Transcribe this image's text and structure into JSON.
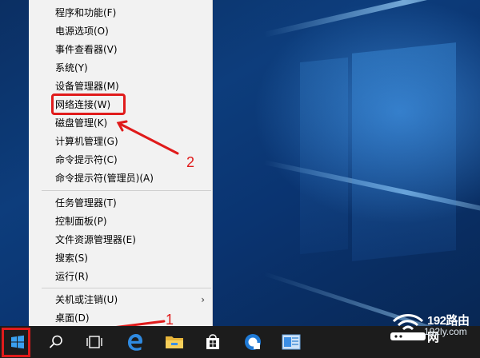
{
  "menu": {
    "items": [
      {
        "label": "程序和功能(F)"
      },
      {
        "label": "电源选项(O)"
      },
      {
        "label": "事件查看器(V)"
      },
      {
        "label": "系统(Y)"
      },
      {
        "label": "设备管理器(M)"
      },
      {
        "label": "网络连接(W)"
      },
      {
        "label": "磁盘管理(K)"
      },
      {
        "label": "计算机管理(G)"
      },
      {
        "label": "命令提示符(C)"
      },
      {
        "label": "命令提示符(管理员)(A)"
      },
      {
        "label": "任务管理器(T)"
      },
      {
        "label": "控制面板(P)"
      },
      {
        "label": "文件资源管理器(E)"
      },
      {
        "label": "搜索(S)"
      },
      {
        "label": "运行(R)"
      },
      {
        "label": "关机或注销(U)"
      },
      {
        "label": "桌面(D)"
      }
    ],
    "submenu_arrow": "›"
  },
  "annotations": {
    "step1": "1",
    "step2": "2",
    "color": "#e01b1b"
  },
  "taskbar": {
    "icons": [
      "windows-start-icon",
      "search-icon",
      "task-view-icon",
      "edge-icon",
      "file-explorer-icon",
      "store-icon",
      "app-icon",
      "app-icon-2"
    ]
  },
  "watermark": {
    "line1": "192路由网",
    "line2": "192ly.com"
  }
}
